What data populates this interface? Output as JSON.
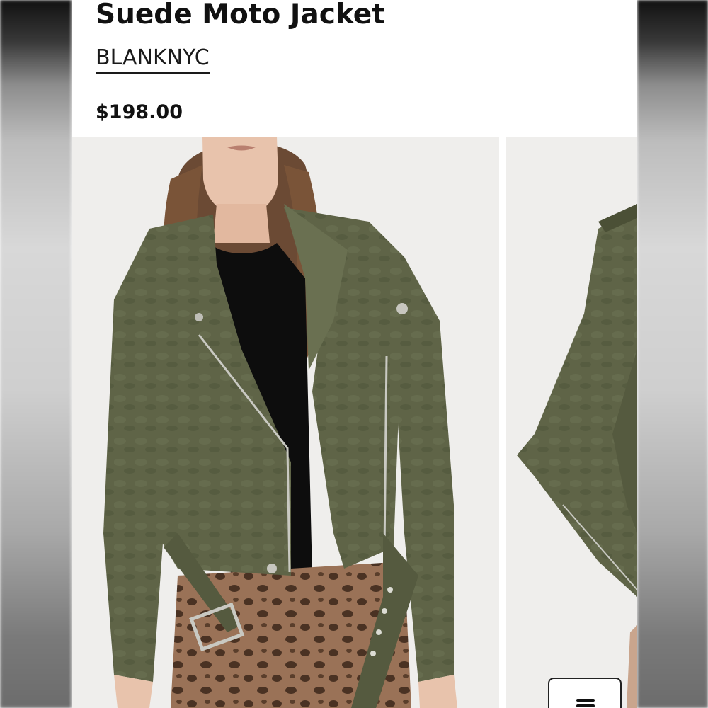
{
  "product": {
    "title": "Suede Moto Jacket",
    "brand": "BLANKNYC",
    "price": "$198.00"
  },
  "gallery": {
    "images": [
      {
        "name": "model-front-view",
        "description": "olive suede moto jacket, black top, leopard jeans"
      },
      {
        "name": "model-side-view",
        "description": "olive suede moto jacket side"
      }
    ]
  },
  "colors": {
    "jacket": "#5f6447",
    "jacket_dark": "#4b5036",
    "top": "#0d0d0d",
    "hair": "#6b4a34",
    "jeans": "#9a7257",
    "leopard_spot": "#4a3223",
    "background": "#efeeec"
  },
  "icons": {
    "filter_button": "menu-bars-icon"
  }
}
